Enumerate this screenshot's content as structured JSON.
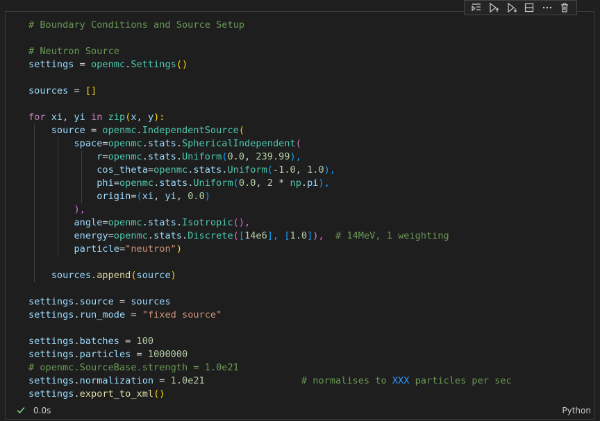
{
  "toolbar": {
    "buttons": [
      {
        "name": "execute-above",
        "icon": "run-above-icon"
      },
      {
        "name": "execute-cell-and-above",
        "icon": "run-up-icon"
      },
      {
        "name": "execute-cell-and-below",
        "icon": "run-down-icon"
      },
      {
        "name": "split-cell",
        "icon": "split-icon"
      },
      {
        "name": "more-actions",
        "icon": "ellipsis-icon"
      },
      {
        "name": "delete-cell",
        "icon": "trash-icon"
      }
    ]
  },
  "code": {
    "l1": "# Boundary Conditions and Source Setup",
    "l3": "# Neutron Source",
    "l4": [
      "settings",
      " = ",
      "openmc",
      ".",
      "Settings",
      "(",
      ")"
    ],
    "l6": [
      "sources",
      " = ",
      "[]"
    ],
    "l8": [
      "for",
      " ",
      "xi",
      ", ",
      "yi",
      " ",
      "in",
      " ",
      "zip",
      "(",
      "x",
      ", ",
      "y",
      "):"
    ],
    "l9": [
      "source",
      " = ",
      "openmc",
      ".",
      "IndependentSource",
      "("
    ],
    "l10": [
      "space",
      "=",
      "openmc",
      ".",
      "stats",
      ".",
      "SphericalIndependent",
      "("
    ],
    "l11": [
      "r",
      "=",
      "openmc",
      ".",
      "stats",
      ".",
      "Uniform",
      "(",
      "0.0",
      ", ",
      "239.99",
      "),"
    ],
    "l12": [
      "cos_theta",
      "=",
      "openmc",
      ".",
      "stats",
      ".",
      "Uniform",
      "(",
      "-1.0",
      ", ",
      "1.0",
      "),"
    ],
    "l13": [
      "phi",
      "=",
      "openmc",
      ".",
      "stats",
      ".",
      "Uniform",
      "(",
      "0.0",
      ", ",
      "2",
      " * ",
      "np",
      ".",
      "pi",
      "),"
    ],
    "l14": [
      "origin",
      "=",
      "(",
      "xi",
      ", ",
      "yi",
      ", ",
      "0.0",
      ")"
    ],
    "l15": [
      "),"
    ],
    "l16": [
      "angle",
      "=",
      "openmc",
      ".",
      "stats",
      ".",
      "Isotropic",
      "(",
      "),"
    ],
    "l17": [
      "energy",
      "=",
      "openmc",
      ".",
      "stats",
      ".",
      "Discrete",
      "(",
      "[",
      "14e6",
      "], ",
      "[",
      "1.0",
      "]",
      "),  ",
      "# 14MeV, 1 weighting"
    ],
    "l18": [
      "particle",
      "=",
      "\"neutron\"",
      ")"
    ],
    "l20": [
      "sources",
      ".",
      "append",
      "(",
      "source",
      ")"
    ],
    "l22": [
      "settings",
      ".",
      "source",
      " = ",
      "sources"
    ],
    "l23": [
      "settings",
      ".",
      "run_mode",
      " = ",
      "\"fixed source\""
    ],
    "l25": [
      "settings",
      ".",
      "batches",
      " = ",
      "100"
    ],
    "l26": [
      "settings",
      ".",
      "particles",
      " = ",
      "1000000"
    ],
    "l27": "# openmc.SourceBase.strength = 1.0e21",
    "l28": [
      "settings",
      ".",
      "normalization",
      " = ",
      "1.0e21",
      "                 ",
      "# normalises to ",
      "XXX",
      " particles per sec"
    ],
    "l29": [
      "settings",
      ".",
      "export_to_xml",
      "(",
      ")"
    ]
  },
  "status": {
    "check_icon": "check-icon",
    "exec_time": "0.0s",
    "language": "Python"
  },
  "colors": {
    "comment": "#6a9955",
    "keyword": "#c586c0",
    "function": "#dcdcaa",
    "variable": "#9cdcfe",
    "class": "#4ec9b0",
    "number": "#b5cea8",
    "string": "#ce9178",
    "check": "#89d185"
  }
}
